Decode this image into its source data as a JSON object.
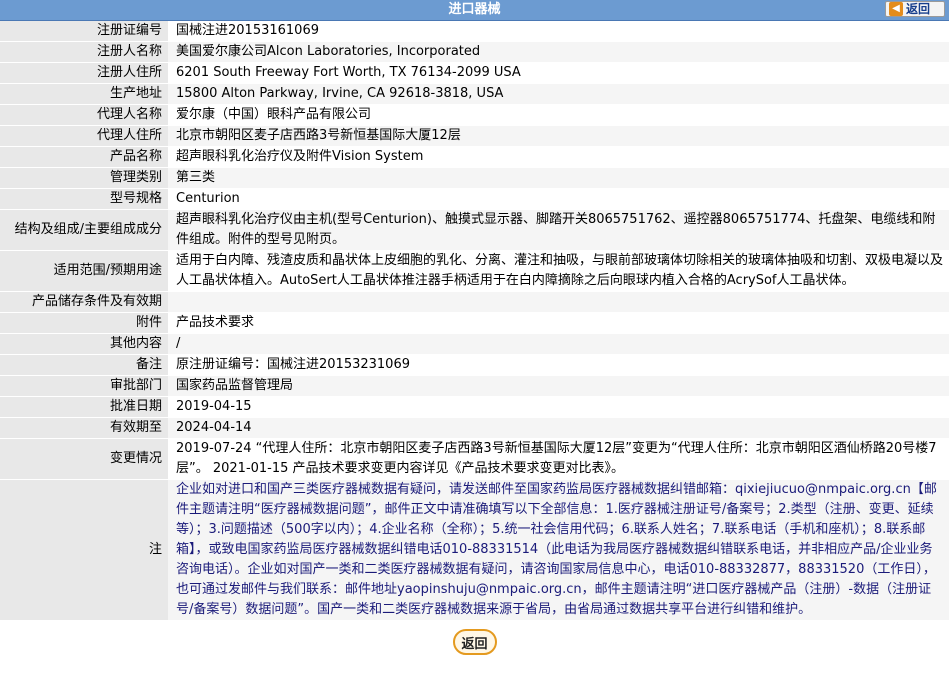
{
  "header": {
    "title": "进口器械",
    "back_label": "返回"
  },
  "rows": [
    {
      "label": "注册证编号",
      "value": "国械注进20153161069"
    },
    {
      "label": "注册人名称",
      "value": "美国爱尔康公司Alcon Laboratories, Incorporated"
    },
    {
      "label": "注册人住所",
      "value": "6201 South Freeway Fort Worth, TX 76134-2099 USA"
    },
    {
      "label": "生产地址",
      "value": "15800 Alton Parkway, Irvine, CA 92618-3818, USA"
    },
    {
      "label": "代理人名称",
      "value": "爱尔康（中国）眼科产品有限公司"
    },
    {
      "label": "代理人住所",
      "value": "北京市朝阳区麦子店西路3号新恒基国际大厦12层"
    },
    {
      "label": "产品名称",
      "value": "超声眼科乳化治疗仪及附件Vision System"
    },
    {
      "label": "管理类别",
      "value": "第三类"
    },
    {
      "label": "型号规格",
      "value": "Centurion"
    },
    {
      "label": "结构及组成/主要组成成分",
      "value": "超声眼科乳化治疗仪由主机(型号Centurion)、触摸式显示器、脚踏开关8065751762、遥控器8065751774、托盘架、电缆线和附件组成。附件的型号见附页。"
    },
    {
      "label": "适用范围/预期用途",
      "value": "适用于白内障、残渣皮质和晶状体上皮细胞的乳化、分离、灌注和抽吸，与眼前部玻璃体切除相关的玻璃体抽吸和切割、双极电凝以及人工晶状体植入。AutoSert人工晶状体推注器手柄适用于在白内障摘除之后向眼球内植入合格的AcrySof人工晶状体。"
    },
    {
      "label": "产品储存条件及有效期",
      "value": ""
    },
    {
      "label": "附件",
      "value": "产品技术要求"
    },
    {
      "label": "其他内容",
      "value": "/"
    },
    {
      "label": "备注",
      "value": "原注册证编号：国械注进20153231069"
    },
    {
      "label": "审批部门",
      "value": "国家药品监督管理局"
    },
    {
      "label": "批准日期",
      "value": "2019-04-15"
    },
    {
      "label": "有效期至",
      "value": "2024-04-14"
    },
    {
      "label": "变更情况",
      "value": "2019-07-24 “代理人住所：北京市朝阳区麦子店西路3号新恒基国际大厦12层”变更为“代理人住所：北京市朝阳区酒仙桥路20号楼7层”。 2021-01-15 产品技术要求变更内容详见《产品技术要求变更对比表》。"
    }
  ],
  "notice": {
    "label": "注",
    "value": "企业如对进口和国产三类医疗器械数据有疑问，请发送邮件至国家药监局医疗器械数据纠错邮箱：qixiejiucuo@nmpaic.org.cn【邮件主题请注明“医疗器械数据问题”，邮件正文中请准确填写以下全部信息：1.医疗器械注册证号/备案号；2.类型（注册、变更、延续等）；3.问题描述（500字以内）；4.企业名称（全称）；5.统一社会信用代码；6.联系人姓名；7.联系电话（手机和座机）；8.联系邮箱】，或致电国家药监局医疗器械数据纠错电话010-88331514（此电话为我局医疗器械数据纠错联系电话，并非相应产品/企业业务咨询电话）。企业如对国产一类和二类医疗器械数据有疑问，请咨询国家局信息中心，电话010-88332877，88331520（工作日），也可通过发邮件与我们联系：邮件地址yaopinshuju@nmpaic.org.cn，邮件主题请注明“进口医疗器械产品（注册）-数据（注册证号/备案号）数据问题”。国产一类和二类医疗器械数据来源于省局，由省局通过数据共享平台进行纠错和维护。"
  },
  "footer": {
    "back_label": "返回"
  },
  "colors": {
    "header_bg": "#6c9bd1",
    "label_bg": "#e8e8e8",
    "accent": "#e49a1f",
    "notice_text": "#1b1b7a"
  }
}
